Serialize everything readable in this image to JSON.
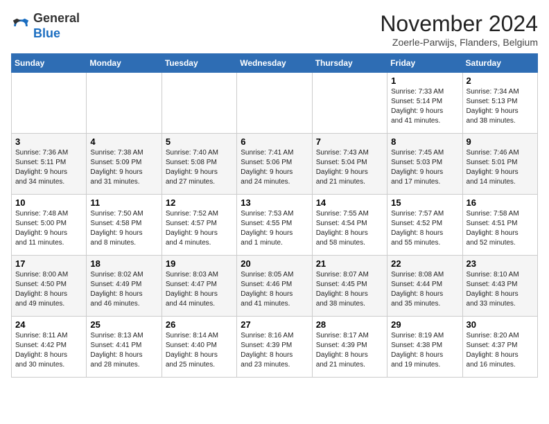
{
  "header": {
    "logo_general": "General",
    "logo_blue": "Blue",
    "title": "November 2024",
    "location": "Zoerle-Parwijs, Flanders, Belgium"
  },
  "calendar": {
    "days_of_week": [
      "Sunday",
      "Monday",
      "Tuesday",
      "Wednesday",
      "Thursday",
      "Friday",
      "Saturday"
    ],
    "weeks": [
      [
        {
          "day": "",
          "info": ""
        },
        {
          "day": "",
          "info": ""
        },
        {
          "day": "",
          "info": ""
        },
        {
          "day": "",
          "info": ""
        },
        {
          "day": "",
          "info": ""
        },
        {
          "day": "1",
          "info": "Sunrise: 7:33 AM\nSunset: 5:14 PM\nDaylight: 9 hours\nand 41 minutes."
        },
        {
          "day": "2",
          "info": "Sunrise: 7:34 AM\nSunset: 5:13 PM\nDaylight: 9 hours\nand 38 minutes."
        }
      ],
      [
        {
          "day": "3",
          "info": "Sunrise: 7:36 AM\nSunset: 5:11 PM\nDaylight: 9 hours\nand 34 minutes."
        },
        {
          "day": "4",
          "info": "Sunrise: 7:38 AM\nSunset: 5:09 PM\nDaylight: 9 hours\nand 31 minutes."
        },
        {
          "day": "5",
          "info": "Sunrise: 7:40 AM\nSunset: 5:08 PM\nDaylight: 9 hours\nand 27 minutes."
        },
        {
          "day": "6",
          "info": "Sunrise: 7:41 AM\nSunset: 5:06 PM\nDaylight: 9 hours\nand 24 minutes."
        },
        {
          "day": "7",
          "info": "Sunrise: 7:43 AM\nSunset: 5:04 PM\nDaylight: 9 hours\nand 21 minutes."
        },
        {
          "day": "8",
          "info": "Sunrise: 7:45 AM\nSunset: 5:03 PM\nDaylight: 9 hours\nand 17 minutes."
        },
        {
          "day": "9",
          "info": "Sunrise: 7:46 AM\nSunset: 5:01 PM\nDaylight: 9 hours\nand 14 minutes."
        }
      ],
      [
        {
          "day": "10",
          "info": "Sunrise: 7:48 AM\nSunset: 5:00 PM\nDaylight: 9 hours\nand 11 minutes."
        },
        {
          "day": "11",
          "info": "Sunrise: 7:50 AM\nSunset: 4:58 PM\nDaylight: 9 hours\nand 8 minutes."
        },
        {
          "day": "12",
          "info": "Sunrise: 7:52 AM\nSunset: 4:57 PM\nDaylight: 9 hours\nand 4 minutes."
        },
        {
          "day": "13",
          "info": "Sunrise: 7:53 AM\nSunset: 4:55 PM\nDaylight: 9 hours\nand 1 minute."
        },
        {
          "day": "14",
          "info": "Sunrise: 7:55 AM\nSunset: 4:54 PM\nDaylight: 8 hours\nand 58 minutes."
        },
        {
          "day": "15",
          "info": "Sunrise: 7:57 AM\nSunset: 4:52 PM\nDaylight: 8 hours\nand 55 minutes."
        },
        {
          "day": "16",
          "info": "Sunrise: 7:58 AM\nSunset: 4:51 PM\nDaylight: 8 hours\nand 52 minutes."
        }
      ],
      [
        {
          "day": "17",
          "info": "Sunrise: 8:00 AM\nSunset: 4:50 PM\nDaylight: 8 hours\nand 49 minutes."
        },
        {
          "day": "18",
          "info": "Sunrise: 8:02 AM\nSunset: 4:49 PM\nDaylight: 8 hours\nand 46 minutes."
        },
        {
          "day": "19",
          "info": "Sunrise: 8:03 AM\nSunset: 4:47 PM\nDaylight: 8 hours\nand 44 minutes."
        },
        {
          "day": "20",
          "info": "Sunrise: 8:05 AM\nSunset: 4:46 PM\nDaylight: 8 hours\nand 41 minutes."
        },
        {
          "day": "21",
          "info": "Sunrise: 8:07 AM\nSunset: 4:45 PM\nDaylight: 8 hours\nand 38 minutes."
        },
        {
          "day": "22",
          "info": "Sunrise: 8:08 AM\nSunset: 4:44 PM\nDaylight: 8 hours\nand 35 minutes."
        },
        {
          "day": "23",
          "info": "Sunrise: 8:10 AM\nSunset: 4:43 PM\nDaylight: 8 hours\nand 33 minutes."
        }
      ],
      [
        {
          "day": "24",
          "info": "Sunrise: 8:11 AM\nSunset: 4:42 PM\nDaylight: 8 hours\nand 30 minutes."
        },
        {
          "day": "25",
          "info": "Sunrise: 8:13 AM\nSunset: 4:41 PM\nDaylight: 8 hours\nand 28 minutes."
        },
        {
          "day": "26",
          "info": "Sunrise: 8:14 AM\nSunset: 4:40 PM\nDaylight: 8 hours\nand 25 minutes."
        },
        {
          "day": "27",
          "info": "Sunrise: 8:16 AM\nSunset: 4:39 PM\nDaylight: 8 hours\nand 23 minutes."
        },
        {
          "day": "28",
          "info": "Sunrise: 8:17 AM\nSunset: 4:39 PM\nDaylight: 8 hours\nand 21 minutes."
        },
        {
          "day": "29",
          "info": "Sunrise: 8:19 AM\nSunset: 4:38 PM\nDaylight: 8 hours\nand 19 minutes."
        },
        {
          "day": "30",
          "info": "Sunrise: 8:20 AM\nSunset: 4:37 PM\nDaylight: 8 hours\nand 16 minutes."
        }
      ]
    ]
  }
}
